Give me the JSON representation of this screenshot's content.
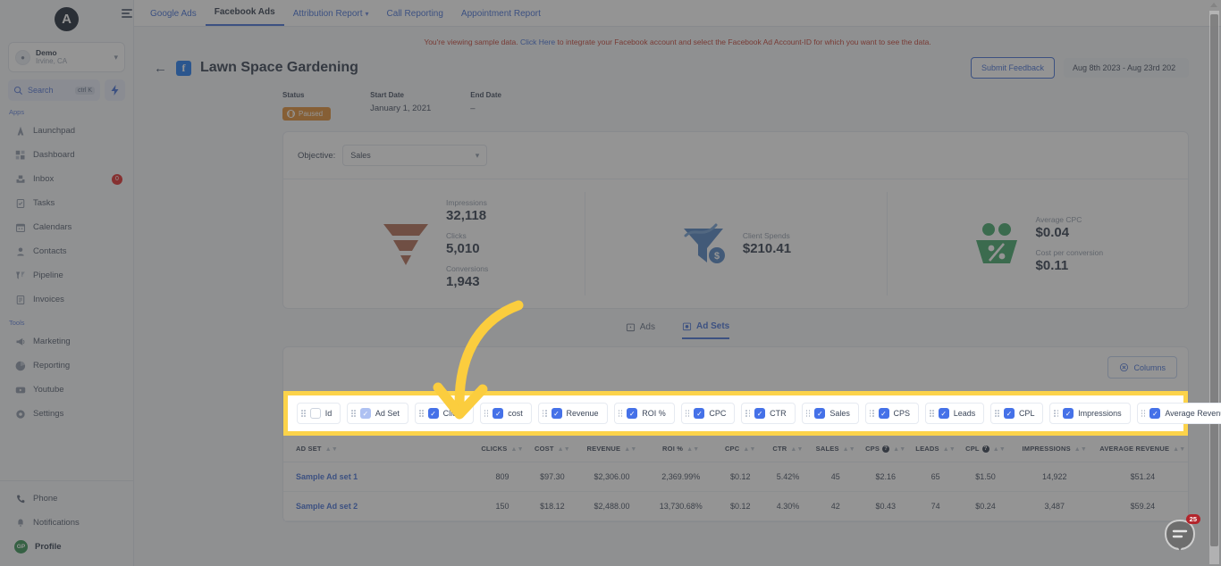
{
  "sidebar": {
    "logo_letter": "A",
    "workspace": {
      "name": "Demo",
      "location": "Irvine, CA"
    },
    "search": {
      "label": "Search",
      "shortcut": "ctrl K"
    },
    "sections": [
      {
        "label": "Apps",
        "items": [
          {
            "label": "Launchpad",
            "icon": "rocket-icon",
            "badge": ""
          },
          {
            "label": "Dashboard",
            "icon": "grid-icon",
            "badge": ""
          },
          {
            "label": "Inbox",
            "icon": "inbox-icon",
            "badge": "0"
          },
          {
            "label": "Tasks",
            "icon": "checklist-icon",
            "badge": ""
          },
          {
            "label": "Calendars",
            "icon": "calendar-icon",
            "badge": ""
          },
          {
            "label": "Contacts",
            "icon": "person-icon",
            "badge": ""
          },
          {
            "label": "Pipeline",
            "icon": "funnel-icon",
            "badge": ""
          },
          {
            "label": "Invoices",
            "icon": "invoice-icon",
            "badge": ""
          }
        ]
      },
      {
        "label": "Tools",
        "items": [
          {
            "label": "Marketing",
            "icon": "megaphone-icon",
            "badge": ""
          },
          {
            "label": "Reporting",
            "icon": "pie-chart-icon",
            "badge": ""
          },
          {
            "label": "Youtube",
            "icon": "youtube-icon",
            "badge": ""
          },
          {
            "label": "Settings",
            "icon": "gear-icon",
            "badge": ""
          }
        ]
      }
    ],
    "bottom": [
      {
        "label": "Phone",
        "icon": "phone-icon"
      },
      {
        "label": "Notifications",
        "icon": "bell-icon"
      }
    ],
    "profile": {
      "initials": "GP",
      "label": "Profile"
    }
  },
  "topnav": {
    "tabs": [
      {
        "label": "Google Ads",
        "active": false,
        "has_caret": false
      },
      {
        "label": "Facebook Ads",
        "active": true,
        "has_caret": false
      },
      {
        "label": "Attribution Report",
        "active": false,
        "has_caret": true
      },
      {
        "label": "Call Reporting",
        "active": false,
        "has_caret": false
      },
      {
        "label": "Appointment Report",
        "active": false,
        "has_caret": false
      }
    ]
  },
  "notice": {
    "before": "You're viewing sample data. ",
    "link": "Click Here",
    "after": " to integrate your Facebook account and select the Facebook Ad Account-ID for which you want to see the data."
  },
  "header": {
    "back_icon": "back-arrow-icon",
    "platform_icon": "facebook-icon",
    "title": "Lawn Space Gardening",
    "feedback_label": "Submit Feedback",
    "date_range": "Aug 8th 2023 - Aug 23rd 202"
  },
  "meta": {
    "status_label": "Status",
    "status_value": "Paused",
    "start_label": "Start Date",
    "start_value": "January 1, 2021",
    "end_label": "End Date",
    "end_value": "–"
  },
  "objective": {
    "label": "Objective:",
    "value": "Sales"
  },
  "kpis": [
    {
      "icon": "funnel-icon",
      "metrics": [
        {
          "label": "Impressions",
          "value": "32,118"
        },
        {
          "label": "Clicks",
          "value": "5,010"
        },
        {
          "label": "Conversions",
          "value": "1,943"
        }
      ]
    },
    {
      "icon": "spend-chart-icon",
      "metrics": [
        {
          "label": "Client Spends",
          "value": "$210.41"
        }
      ]
    },
    {
      "icon": "people-percent-icon",
      "metrics": [
        {
          "label": "Average CPC",
          "value": "$0.04"
        },
        {
          "label": "Cost per conversion",
          "value": "$0.11"
        }
      ]
    }
  ],
  "subtabs": [
    {
      "label": "Ads",
      "active": false,
      "icon": "ads-icon"
    },
    {
      "label": "Ad Sets",
      "active": true,
      "icon": "adsets-icon"
    }
  ],
  "columns_button": {
    "label": "Columns",
    "icon": "columns-icon"
  },
  "column_chips": [
    {
      "label": "Id",
      "state": "off"
    },
    {
      "label": "Ad Set",
      "state": "dim"
    },
    {
      "label": "Clicks",
      "state": "on"
    },
    {
      "label": "cost",
      "state": "on"
    },
    {
      "label": "Revenue",
      "state": "on"
    },
    {
      "label": "ROI %",
      "state": "on"
    },
    {
      "label": "CPC",
      "state": "on"
    },
    {
      "label": "CTR",
      "state": "on"
    },
    {
      "label": "Sales",
      "state": "on"
    },
    {
      "label": "CPS",
      "state": "on"
    },
    {
      "label": "Leads",
      "state": "on"
    },
    {
      "label": "CPL",
      "state": "on"
    },
    {
      "label": "Impressions",
      "state": "on"
    },
    {
      "label": "Average Revenue",
      "state": "on"
    }
  ],
  "table": {
    "headers": [
      {
        "label": "AD SET",
        "info": false,
        "sortable": true
      },
      {
        "label": "CLICKS",
        "info": false,
        "sortable": true
      },
      {
        "label": "COST",
        "info": false,
        "sortable": true
      },
      {
        "label": "REVENUE",
        "info": false,
        "sortable": true
      },
      {
        "label": "ROI %",
        "info": false,
        "sortable": true
      },
      {
        "label": "CPC",
        "info": false,
        "sortable": true
      },
      {
        "label": "CTR",
        "info": false,
        "sortable": true
      },
      {
        "label": "SALES",
        "info": false,
        "sortable": true
      },
      {
        "label": "CPS",
        "info": true,
        "sortable": true
      },
      {
        "label": "LEADS",
        "info": false,
        "sortable": true
      },
      {
        "label": "CPL",
        "info": true,
        "sortable": true
      },
      {
        "label": "IMPRESSIONS",
        "info": false,
        "sortable": true
      },
      {
        "label": "AVERAGE REVENUE",
        "info": false,
        "sortable": true
      }
    ],
    "rows": [
      [
        "Sample Ad set 1",
        "809",
        "$97.30",
        "$2,306.00",
        "2,369.99%",
        "$0.12",
        "5.42%",
        "45",
        "$2.16",
        "65",
        "$1.50",
        "14,922",
        "$51.24"
      ],
      [
        "Sample Ad set 2",
        "150",
        "$18.12",
        "$2,488.00",
        "13,730.68%",
        "$0.12",
        "4.30%",
        "42",
        "$0.43",
        "74",
        "$0.24",
        "3,487",
        "$59.24"
      ]
    ]
  },
  "chat": {
    "badge": "25",
    "icon": "chat-icon"
  },
  "annotation": {
    "type": "curved-arrow",
    "color": "#fbcd3e"
  },
  "colors": {
    "accent_blue": "#3d6ad6",
    "checkbox_blue": "#4571e8",
    "highlight_yellow": "#fcd34a",
    "status_orange": "#e08b2e",
    "notice_red": "#c0392b",
    "funnel_brown": "#b0674f",
    "spend_blue": "#4a7fc1",
    "people_green": "#3aa564"
  }
}
